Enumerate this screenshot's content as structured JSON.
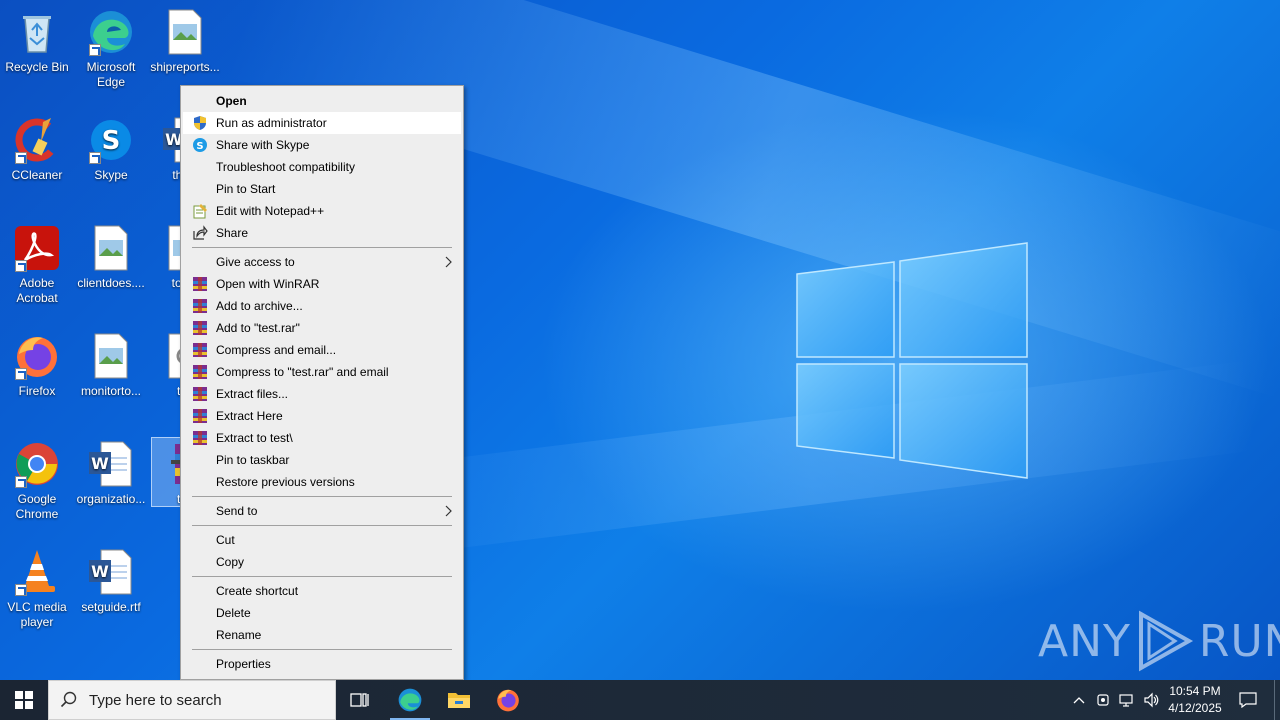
{
  "desktop": {
    "icons": [
      {
        "label": "Recycle Bin"
      },
      {
        "label": "Microsoft Edge"
      },
      {
        "label": "shipreports..."
      },
      {
        "label": "CCleaner"
      },
      {
        "label": "Skype"
      },
      {
        "label": "thew"
      },
      {
        "label": "Adobe Acrobat"
      },
      {
        "label": "clientdoes...."
      },
      {
        "label": "toget"
      },
      {
        "label": "Firefox"
      },
      {
        "label": "monitorto..."
      },
      {
        "label": "tes"
      },
      {
        "label": "Google Chrome"
      },
      {
        "label": "organizatio..."
      },
      {
        "label": "tes"
      },
      {
        "label": "VLC media player"
      },
      {
        "label": "setguide.rtf"
      }
    ]
  },
  "context_menu": {
    "items": [
      {
        "label": "Open"
      },
      {
        "label": "Run as administrator"
      },
      {
        "label": "Share with Skype"
      },
      {
        "label": "Troubleshoot compatibility"
      },
      {
        "label": "Pin to Start"
      },
      {
        "label": "Edit with Notepad++"
      },
      {
        "label": "Share"
      },
      {
        "label": "Give access to"
      },
      {
        "label": "Open with WinRAR"
      },
      {
        "label": "Add to archive..."
      },
      {
        "label": "Add to \"test.rar\""
      },
      {
        "label": "Compress and email..."
      },
      {
        "label": "Compress to \"test.rar\" and email"
      },
      {
        "label": "Extract files..."
      },
      {
        "label": "Extract Here"
      },
      {
        "label": "Extract to test\\"
      },
      {
        "label": "Pin to taskbar"
      },
      {
        "label": "Restore previous versions"
      },
      {
        "label": "Send to"
      },
      {
        "label": "Cut"
      },
      {
        "label": "Copy"
      },
      {
        "label": "Create shortcut"
      },
      {
        "label": "Delete"
      },
      {
        "label": "Rename"
      },
      {
        "label": "Properties"
      }
    ]
  },
  "taskbar": {
    "search_placeholder": "Type here to search",
    "time": "10:54 PM",
    "date": "4/12/2025"
  },
  "watermark": {
    "text": "ANY",
    "text2": "RUN"
  }
}
